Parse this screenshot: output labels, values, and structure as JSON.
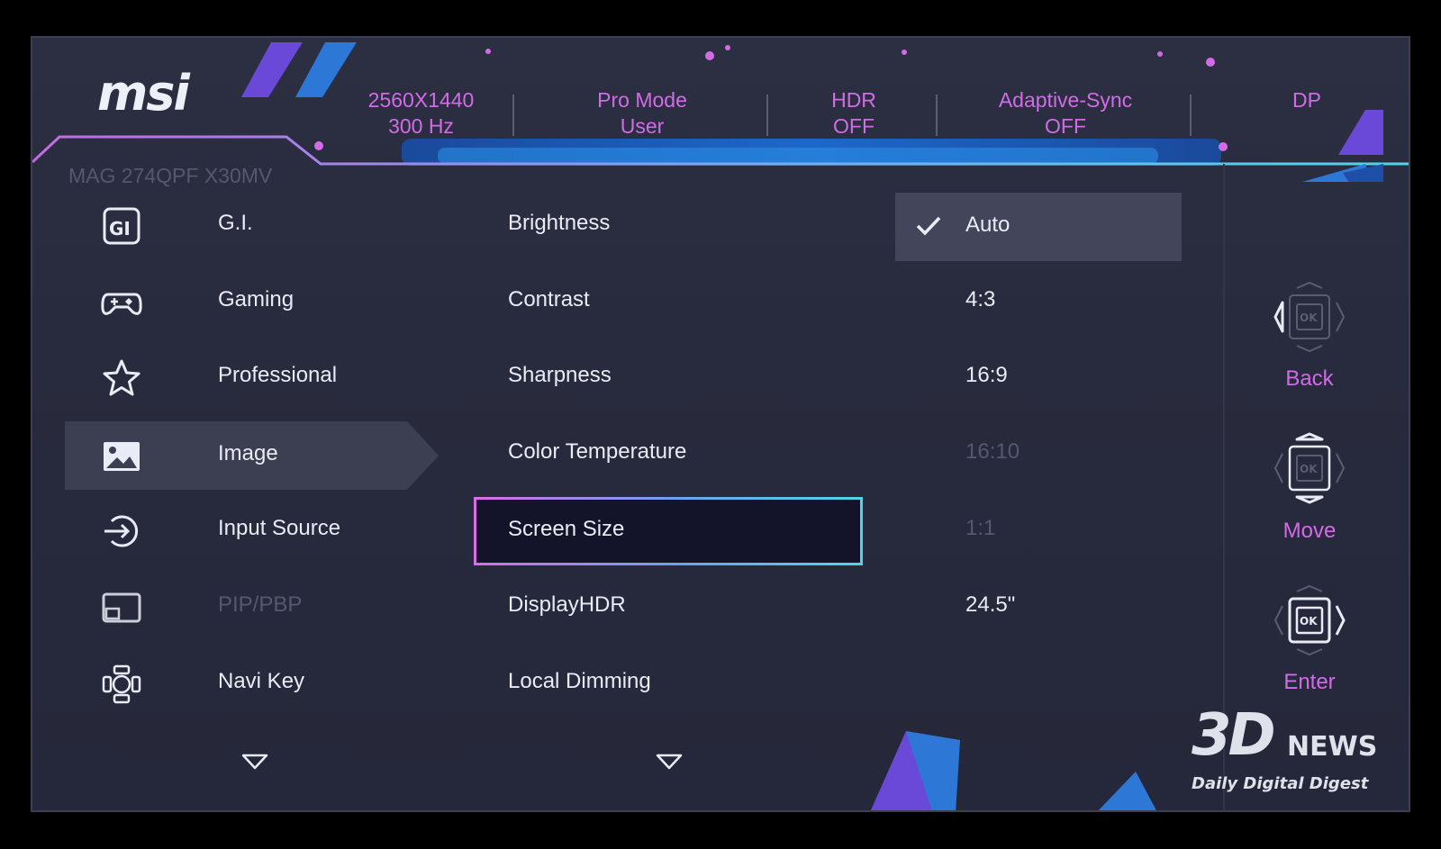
{
  "brand": {
    "logo_text": "msi",
    "model": "MAG 274QPF X30MV"
  },
  "status_bar": [
    {
      "line1": "2560X1440",
      "line2": "300 Hz"
    },
    {
      "line1": "Pro Mode",
      "line2": "User"
    },
    {
      "line1": "HDR",
      "line2": "OFF"
    },
    {
      "line1": "Adaptive-Sync",
      "line2": "OFF"
    },
    {
      "line1": "DP",
      "line2": ""
    }
  ],
  "nav": [
    {
      "label": "G.I.",
      "icon": "gi-icon",
      "state": "normal"
    },
    {
      "label": "Gaming",
      "icon": "gamepad-icon",
      "state": "normal"
    },
    {
      "label": "Professional",
      "icon": "star-icon",
      "state": "normal"
    },
    {
      "label": "Image",
      "icon": "image-icon",
      "state": "selected"
    },
    {
      "label": "Input Source",
      "icon": "input-source-icon",
      "state": "normal"
    },
    {
      "label": "PIP/PBP",
      "icon": "pip-icon",
      "state": "disabled"
    },
    {
      "label": "Navi Key",
      "icon": "navi-key-icon",
      "state": "normal"
    }
  ],
  "options": [
    {
      "label": "Brightness",
      "state": "normal"
    },
    {
      "label": "Contrast",
      "state": "normal"
    },
    {
      "label": "Sharpness",
      "state": "normal"
    },
    {
      "label": "Color Temperature",
      "state": "normal"
    },
    {
      "label": "Screen Size",
      "state": "focused"
    },
    {
      "label": "DisplayHDR",
      "state": "normal"
    },
    {
      "label": "Local Dimming",
      "state": "normal"
    }
  ],
  "values": [
    {
      "label": "Auto",
      "state": "selected",
      "checked": true
    },
    {
      "label": "4:3",
      "state": "normal"
    },
    {
      "label": "16:9",
      "state": "normal"
    },
    {
      "label": "16:10",
      "state": "disabled"
    },
    {
      "label": "1:1",
      "state": "disabled"
    },
    {
      "label": "24.5\"",
      "state": "normal"
    }
  ],
  "keys": [
    {
      "label": "Back",
      "icon": "joystick-left-icon"
    },
    {
      "label": "Move",
      "icon": "joystick-updown-icon"
    },
    {
      "label": "Enter",
      "icon": "joystick-press-icon"
    }
  ],
  "watermark": {
    "logo": "3D",
    "name": "NEWS",
    "tagline": "Daily Digital Digest"
  },
  "colors": {
    "accent": "#d16ce6",
    "cyan": "#4cd6ea",
    "panel": "#2c2e42",
    "selected_bg": "#3c3e52"
  }
}
